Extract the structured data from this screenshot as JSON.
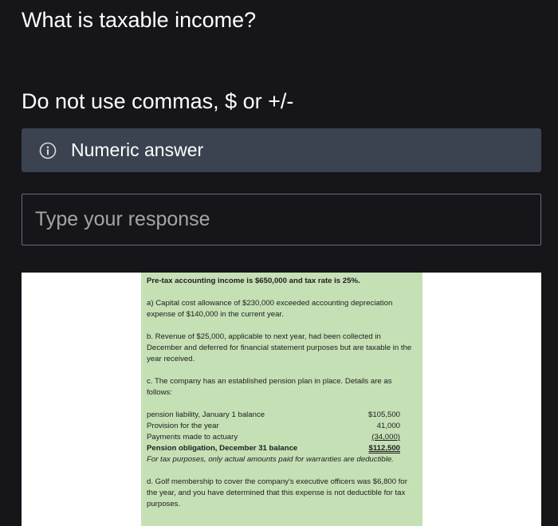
{
  "question": {
    "title": "What is taxable income?",
    "instruction": "Do not use commas, $ or +/-"
  },
  "hint": {
    "icon": "info-icon",
    "text": "Numeric answer"
  },
  "response": {
    "placeholder": "Type your response",
    "value": ""
  },
  "problem": {
    "heading": "Pre-tax accounting income is $650,000 and tax rate is 25%.",
    "item_a": "a) Capital cost allowance of $230,000 exceeded accounting depreciation expense of $140,000 in the current year.",
    "item_b": "b. Revenue of $25,000, applicable to next year, had been collected in December and deferred for financial statement purposes but are taxable in the year received.",
    "item_c": "c. The company has an established pension plan in place. Details are as follows:",
    "pension_rows": [
      {
        "label": "pension liability, January 1 balance",
        "amount": "$105,500"
      },
      {
        "label": "Provision for the year",
        "amount": "41,000"
      },
      {
        "label": "Payments made to actuary",
        "amount": "(34,000)"
      },
      {
        "label": "Pension obligation, December 31 balance",
        "amount": "$112,500"
      }
    ],
    "tax_note": "For tax purposes, only actual amounts paid for warranties are deductible.",
    "item_d": "d. Golf membership to cover the company's executive officers was $6,800 for the year, and you have determined that this expense is not deductible for tax purposes."
  },
  "colors": {
    "background": "#16161a",
    "hint_box": "#3b4350",
    "sheet_green": "#c5e0b5"
  }
}
